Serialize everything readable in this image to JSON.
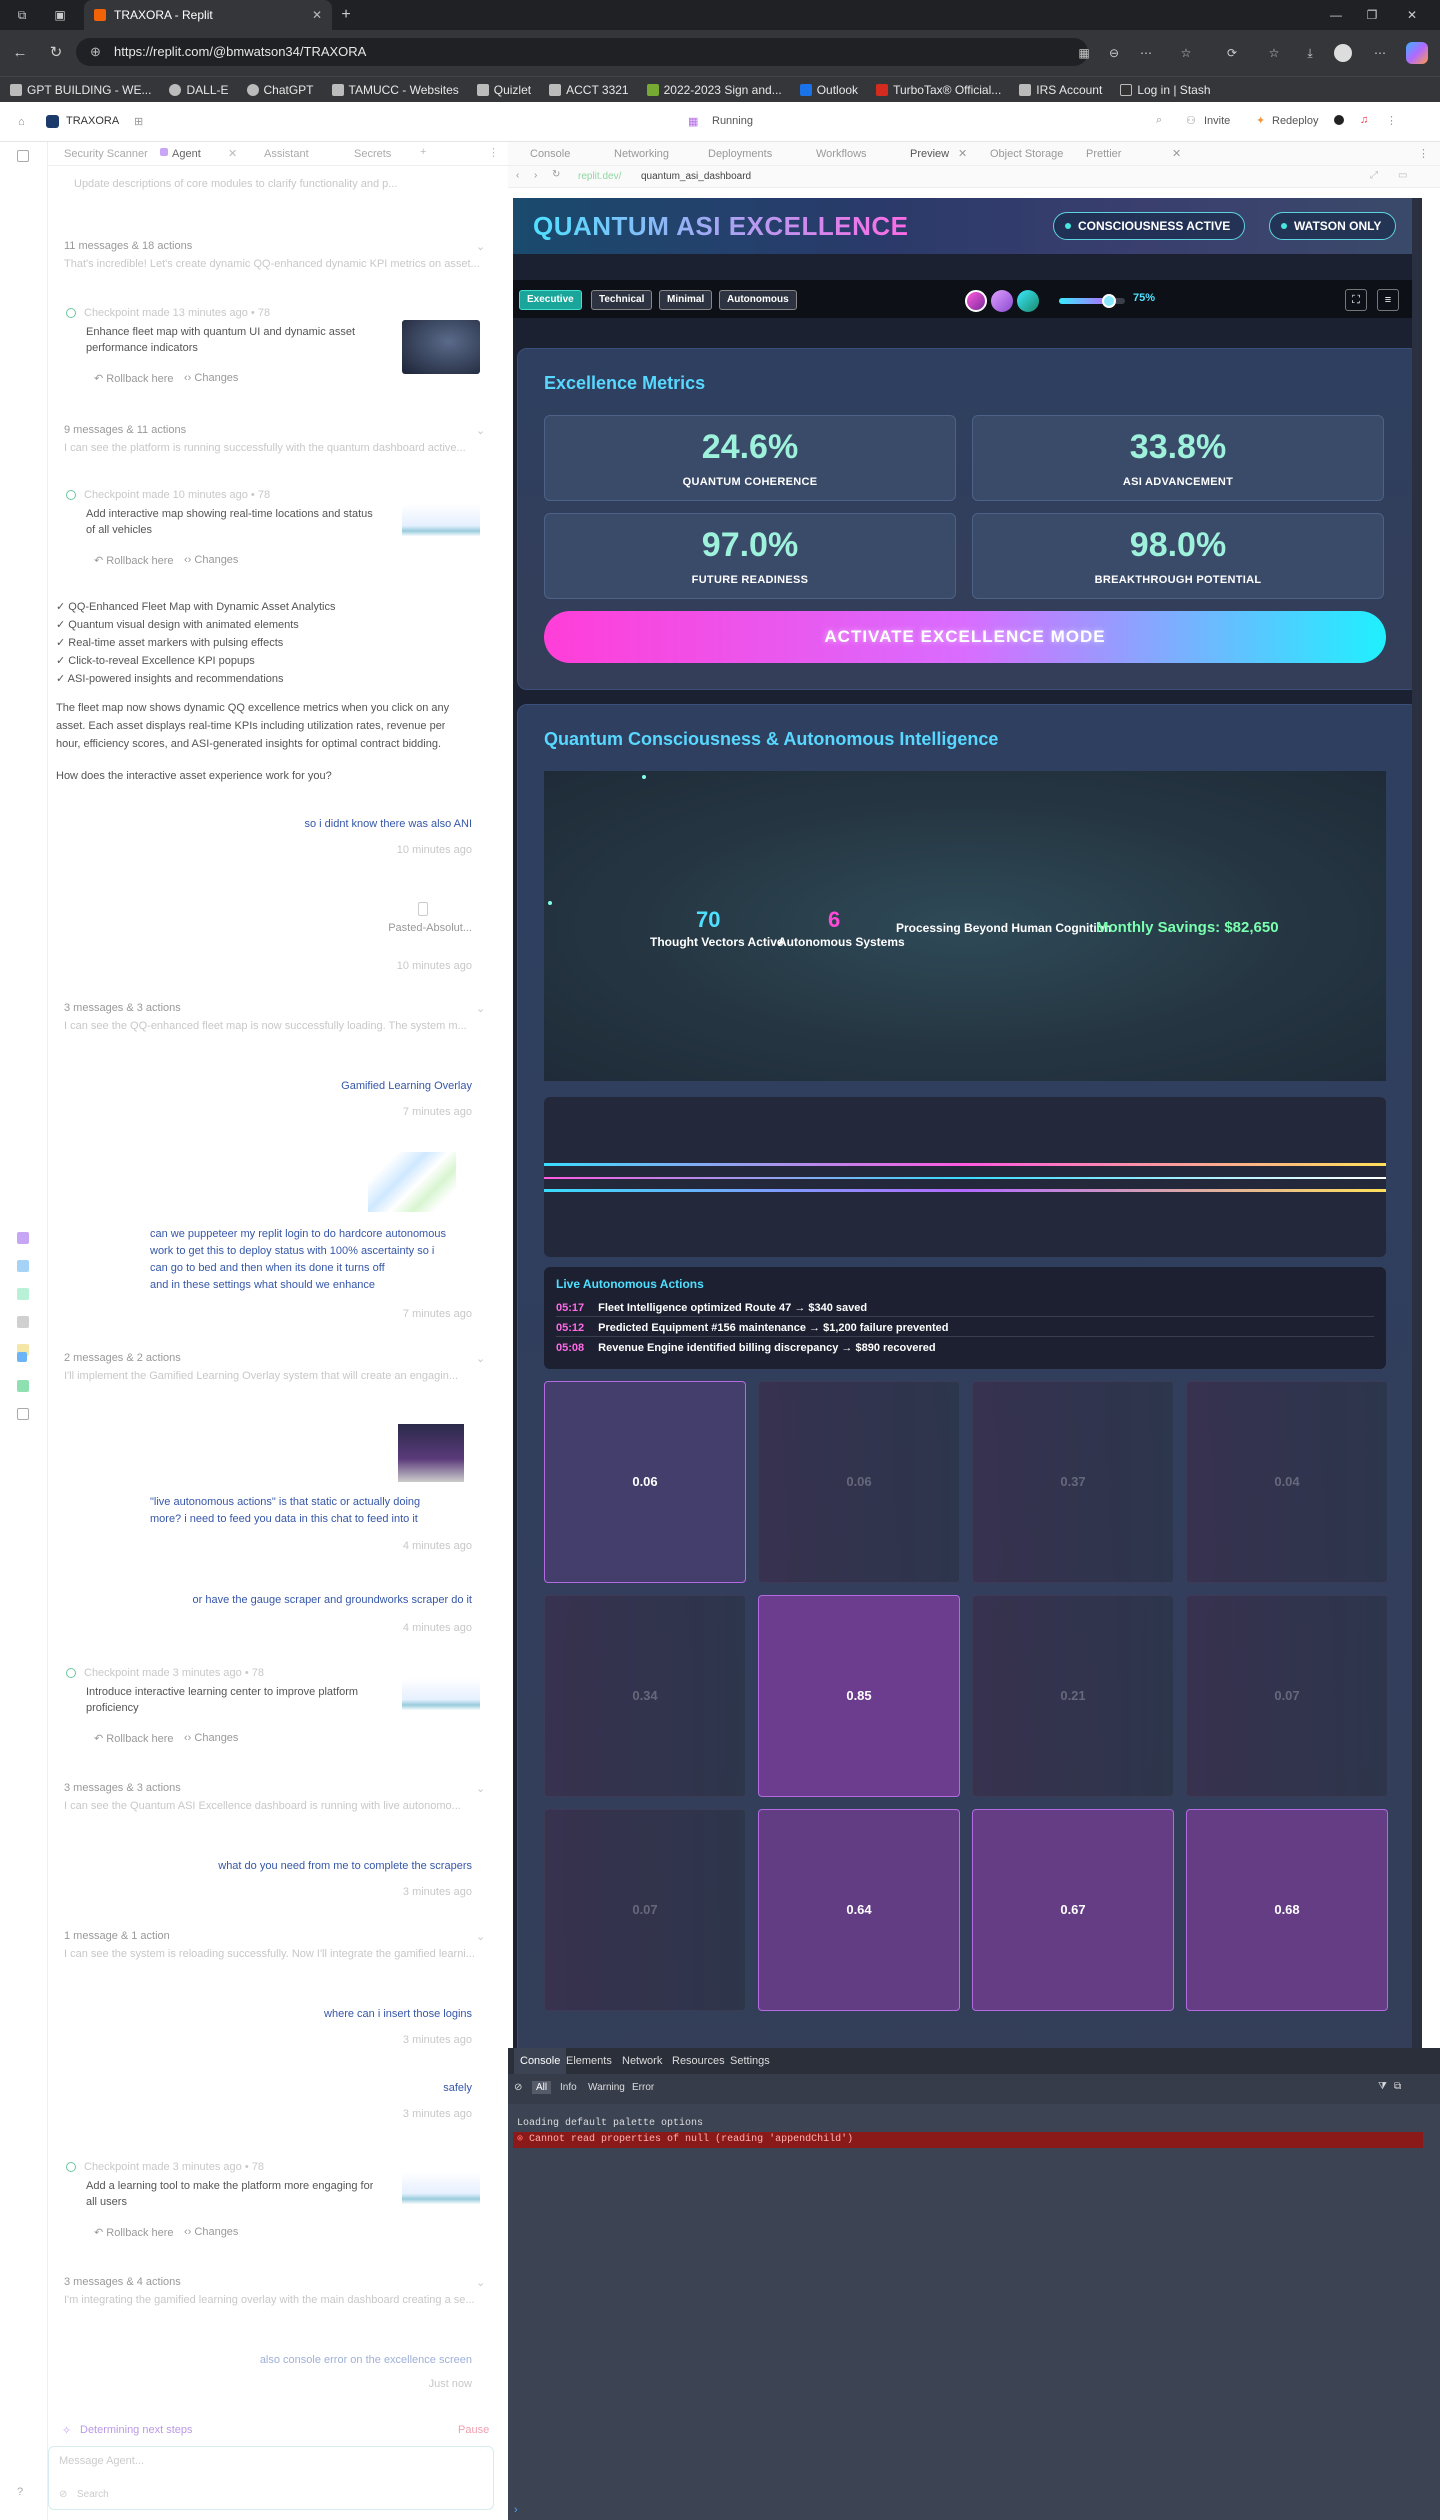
{
  "browser": {
    "tab_title": "TRAXORA - Replit",
    "url": "https://replit.com/@bmwatson34/TRAXORA",
    "bookmarks": [
      "GPT BUILDING - WE...",
      "DALL-E",
      "ChatGPT",
      "TAMUCC - Websites",
      "Quizlet",
      "ACCT 3321",
      "2022-2023 Sign and...",
      "Outlook",
      "TurboTax® Official...",
      "IRS Account",
      "Log in | Stash"
    ]
  },
  "replit": {
    "project": "TRAXORA",
    "status": "Running",
    "invite": "Invite",
    "redeploy": "Redeploy",
    "left_tabs": [
      "Security Scanner",
      "Agent",
      "Assistant",
      "Secrets"
    ],
    "right_tabs": [
      "Console",
      "Networking",
      "Deployments",
      "Workflows",
      "Preview",
      "Object Storage",
      "Prettier"
    ],
    "preview_path_prefix": "replit.dev/",
    "preview_path": "quantum_asi_dashboard"
  },
  "chat": {
    "top_line": "Update descriptions of core modules to clarify functionality and p...",
    "g1_header": "11 messages & 18 actions",
    "g1_sub": "That's incredible! Let's create dynamic QQ-enhanced dynamic KPI metrics on asset...",
    "cp1_meta": "Checkpoint made 13 minutes ago • 78",
    "cp1_text": [
      "Enhance fleet map with quantum UI and dynamic asset",
      "performance indicators"
    ],
    "rollback": "Rollback here",
    "changes": "Changes",
    "g2_header": "9 messages & 11 actions",
    "g2_sub": "I can see the platform is running successfully with the quantum dashboard active...",
    "cp2_meta": "Checkpoint made 10 minutes ago • 78",
    "cp2_text": [
      "Add interactive map showing real-time locations and status",
      "of all vehicles"
    ],
    "bullets": [
      "✓ QQ-Enhanced Fleet Map with Dynamic Asset Analytics",
      "✓ Quantum visual design with animated elements",
      "✓ Real-time asset markers with pulsing effects",
      "✓ Click-to-reveal Excellence KPI popups",
      "✓ ASI-powered insights and recommendations"
    ],
    "para": [
      "The fleet map now shows dynamic QQ excellence metrics when you click on any",
      "asset. Each asset displays real-time KPIs including utilization rates, revenue per",
      "hour, efficiency scores, and ASI-generated insights for optimal contract bidding."
    ],
    "question": "How does the interactive asset experience work for you?",
    "u1": "so i didnt know there was also ANI",
    "u1_time": "10 minutes ago",
    "u2": "Pasted-Absolut...",
    "u2_time": "10 minutes ago",
    "g3_header": "3 messages & 3 actions",
    "g3_sub": "I can see the QQ-enhanced fleet map is now successfully loading. The system m...",
    "u3": "Gamified Learning Overlay",
    "u3_time": "7 minutes ago",
    "u4": [
      "can we puppeteer my replit login to do hardcore autonomous",
      "work to get this to deploy status with 100% ascertainty so i",
      "can go to bed and then when its done it turns off",
      "and in these settings what should we enhance"
    ],
    "u4_time": "7 minutes ago",
    "g4_header": "2 messages & 2 actions",
    "g4_sub": "I'll implement the Gamified Learning Overlay system that will create an engagin...",
    "u5": [
      "\"live autonomous actions\" is that static or actually doing",
      "more? i need to feed you data in this chat to feed into it"
    ],
    "u5_time": "4 minutes ago",
    "u6": "or have the gauge scraper and groundworks scraper do it",
    "u6_time": "4 minutes ago",
    "cp3_meta": "Checkpoint made 3 minutes ago • 78",
    "cp3_text": [
      "Introduce interactive learning center to improve platform",
      "proficiency"
    ],
    "g5_header": "3 messages & 3 actions",
    "g5_sub": "I can see the Quantum ASI Excellence dashboard is running with live autonomo...",
    "u7": "what do you need from me to complete the scrapers",
    "u7_time": "3 minutes ago",
    "g6_header": "1 message & 1 action",
    "g6_sub": "I can see the system is reloading successfully. Now I'll integrate the gamified learni...",
    "u8": "where can i insert those logins",
    "u8_time": "3 minutes ago",
    "u9": "safely",
    "u9_time": "3 minutes ago",
    "cp4_meta": "Checkpoint made 3 minutes ago • 78",
    "cp4_text": [
      "Add a learning tool to make the platform more engaging for",
      "all users"
    ],
    "g7_header": "3 messages & 4 actions",
    "g7_sub": "I'm integrating the gamified learning overlay with the main dashboard creating a se...",
    "u10": "also console error on the excellence screen",
    "u10_time": "Just now",
    "working": "Determining next steps",
    "pause": "Pause",
    "input_placeholder": "Message Agent...",
    "search_hint": "Search"
  },
  "dashboard": {
    "title": "QUANTUM ASI EXCELLENCE",
    "pill1": "CONSCIOUSNESS ACTIVE",
    "pill2": "WATSON ONLY",
    "views": [
      "Executive",
      "Technical",
      "Minimal",
      "Autonomous"
    ],
    "intensity": "75%",
    "intensity_value": 0.75,
    "metrics_title": "Excellence Metrics",
    "metrics": [
      {
        "value": "24.6%",
        "label": "QUANTUM COHERENCE"
      },
      {
        "value": "33.8%",
        "label": "ASI ADVANCEMENT"
      },
      {
        "value": "97.0%",
        "label": "FUTURE READINESS"
      },
      {
        "value": "98.0%",
        "label": "BREAKTHROUGH POTENTIAL"
      }
    ],
    "activate": "ACTIVATE EXCELLENCE MODE",
    "consciousness_title": "Quantum Consciousness & Autonomous Intelligence",
    "thought_count": "70",
    "thought_label": "Thought Vectors Active",
    "systems_count": "6",
    "systems_label": "Autonomous Systems",
    "processing": "Processing Beyond Human Cognition",
    "savings": "Monthly Savings: $82,650",
    "actions_title": "Live Autonomous Actions",
    "actions": [
      {
        "time": "05:17",
        "text": "Fleet Intelligence optimized Route 47 → $340 saved"
      },
      {
        "time": "05:12",
        "text": "Predicted Equipment #156 maintenance → $1,200 failure prevented"
      },
      {
        "time": "05:08",
        "text": "Revenue Engine identified billing discrepancy → $890 recovered"
      }
    ],
    "grid": [
      "0.06",
      "0.06",
      "0.37",
      "0.04",
      "0.34",
      "0.85",
      "0.21",
      "0.07",
      "0.07",
      "0.64",
      "0.67",
      "0.68"
    ]
  },
  "devtools": {
    "tabs": [
      "Console",
      "Elements",
      "Network",
      "Resources",
      "Settings"
    ],
    "filters": [
      "All",
      "Info",
      "Warning",
      "Error"
    ],
    "log": "Loading default palette options",
    "error": "Cannot read properties of null (reading 'appendChild')",
    "prompt": "›"
  },
  "colors": {
    "accent_cyan": "#58d8ff",
    "accent_pink": "#ff3ed8",
    "metric_value": "#9ef2dc",
    "error_bg": "#8a1a1a"
  }
}
